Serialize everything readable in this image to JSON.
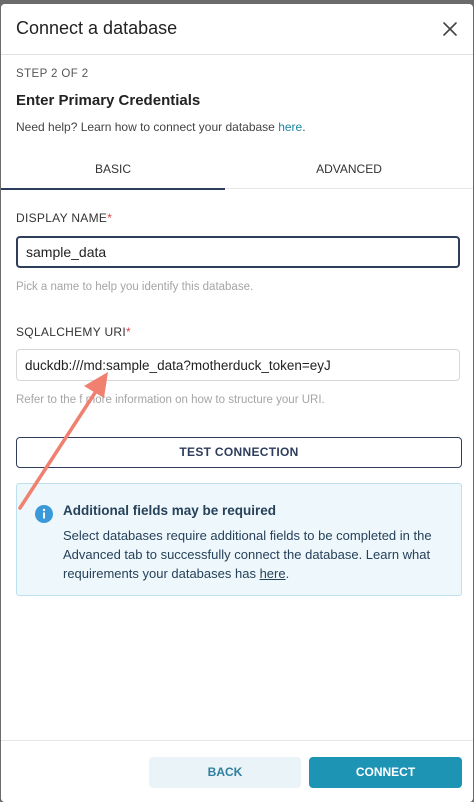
{
  "modal": {
    "title": "Connect a database",
    "step": "STEP 2 OF 2",
    "section_title": "Enter Primary Credentials",
    "help_text": "Need help? Learn how to connect your database ",
    "help_link": "here",
    "help_suffix": "."
  },
  "tabs": [
    {
      "label": "BASIC",
      "active": true
    },
    {
      "label": "ADVANCED",
      "active": false
    }
  ],
  "display_name": {
    "label": "DISPLAY NAME",
    "required_mark": "*",
    "value": "sample_data",
    "hint": "Pick a name to help you identify this database."
  },
  "sqlalchemy_uri": {
    "label": "SQLALCHEMY URI",
    "required_mark": "*",
    "value": "duckdb:///md:sample_data?motherduck_token=eyJ",
    "hint": "Refer to the f  more information on how to structure your URI."
  },
  "test_connection_label": "TEST CONNECTION",
  "alert": {
    "title": "Additional fields may be required",
    "body": "Select databases require additional fields to be completed in the Advanced tab to successfully connect the database. Learn what requirements your databases has ",
    "link": "here",
    "suffix": "."
  },
  "footer": {
    "back_label": "BACK",
    "connect_label": "CONNECT"
  },
  "colors": {
    "accent": "#1e94b5",
    "navy": "#2e3d5c",
    "annotation_arrow": "#f08070"
  },
  "icons": {
    "close": "close-icon",
    "info": "info-icon"
  }
}
